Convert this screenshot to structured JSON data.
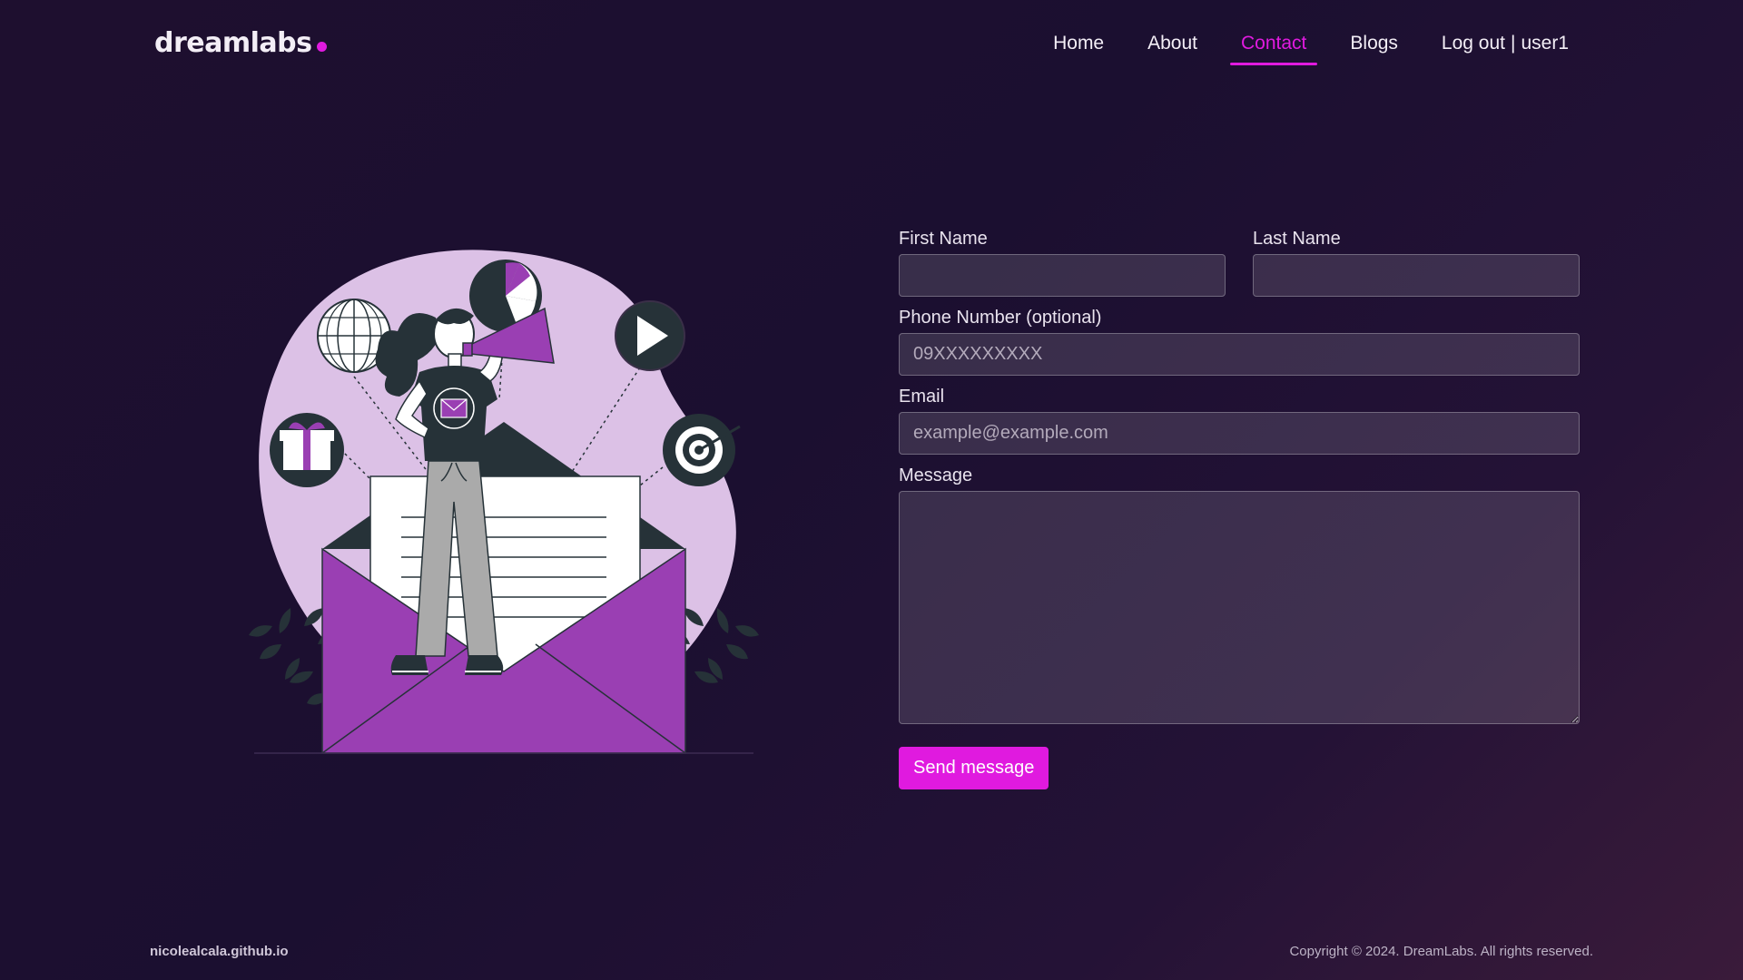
{
  "brand": {
    "name": "dreamlabs",
    "accent": "#e01adf"
  },
  "nav": {
    "items": [
      {
        "label": "Home",
        "active": false
      },
      {
        "label": "About",
        "active": false
      },
      {
        "label": "Contact",
        "active": true
      },
      {
        "label": "Blogs",
        "active": false
      }
    ],
    "logout_label": "Log out",
    "separator": "|",
    "username": "user1"
  },
  "illustration": {
    "icons": [
      "globe-icon",
      "pie-chart-icon",
      "play-icon",
      "gift-icon",
      "target-icon",
      "megaphone-icon",
      "envelope-icon"
    ]
  },
  "form": {
    "first_name": {
      "label": "First Name",
      "value": "",
      "placeholder": ""
    },
    "last_name": {
      "label": "Last Name",
      "value": "",
      "placeholder": ""
    },
    "phone": {
      "label": "Phone Number (optional)",
      "value": "",
      "placeholder": "09XXXXXXXXX"
    },
    "email": {
      "label": "Email",
      "value": "",
      "placeholder": "example@example.com"
    },
    "message": {
      "label": "Message",
      "value": "",
      "placeholder": ""
    },
    "submit_label": "Send message"
  },
  "footer": {
    "site": "nicolealcala.github.io",
    "copyright": "Copyright © 2024. DreamLabs. All rights reserved."
  },
  "colors": {
    "accent": "#e01adf",
    "background": "#1e0f2f",
    "illustration_purple": "#9a3fb3",
    "illustration_blob": "#dcc1e6",
    "illustration_dark": "#263238"
  }
}
